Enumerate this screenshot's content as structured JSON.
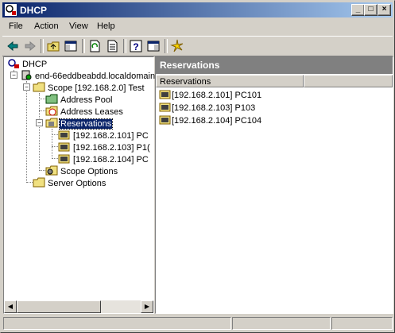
{
  "window": {
    "title": "DHCP"
  },
  "menu": [
    "File",
    "Action",
    "View",
    "Help"
  ],
  "tree": {
    "root": "DHCP",
    "server": "end-66eddbeabdd.localdomain [",
    "scope": "Scope [192.168.2.0] Test",
    "address_pool": "Address Pool",
    "address_leases": "Address Leases",
    "reservations": "Reservations",
    "res1": "[192.168.2.101] PC",
    "res2": "[192.168.2.103] P1(",
    "res3": "[192.168.2.104] PC",
    "scope_options": "Scope Options",
    "server_options": "Server Options"
  },
  "right_pane": {
    "header": "Reservations",
    "column": "Reservations",
    "items": [
      "[192.168.2.101] PC101",
      "[192.168.2.103] P103",
      "[192.168.2.104] PC104"
    ]
  },
  "icons": {
    "toolbar": [
      "back-icon",
      "forward-icon",
      "up-one-level-icon",
      "show-hide-console-tree-icon",
      "refresh-icon",
      "export-list-icon",
      "help-icon",
      "show-hide-action-pane-icon",
      "new-icon"
    ]
  },
  "colors": {
    "selection": "#0a246a",
    "titlebar_start": "#0a246a",
    "titlebar_end": "#a6caf0",
    "header_band": "#808080"
  }
}
